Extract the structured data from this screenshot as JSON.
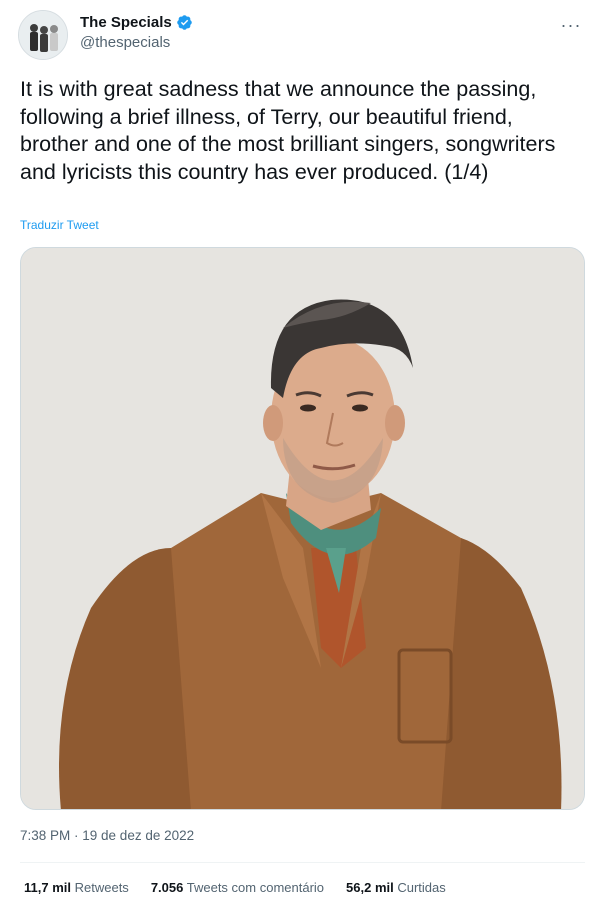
{
  "author": {
    "display_name": "The Specials",
    "handle": "@thespecials",
    "verified": true
  },
  "tweet": {
    "text": "It is with great sadness that we announce the passing, following a brief illness, of Terry, our beautiful friend, brother and one of the most brilliant singers, songwriters and lyricists this country has ever produced. (1/4)",
    "translate_label": "Traduzir Tweet",
    "timestamp": "7:38 PM · 19 de dez de 2022"
  },
  "stats": [
    {
      "value": "11,7 mil",
      "label": "Retweets"
    },
    {
      "value": "7.056",
      "label": "Tweets com comentário"
    },
    {
      "value": "56,2 mil",
      "label": "Curtidas"
    }
  ],
  "icons": {
    "more": "more-horizontal-icon",
    "verified": "verified-badge-icon"
  },
  "colors": {
    "accent": "#1d9bf0",
    "text_primary": "#0f1419",
    "text_secondary": "#536471",
    "jacket": "#a0673a",
    "photo_background": "#e6e4e0"
  }
}
